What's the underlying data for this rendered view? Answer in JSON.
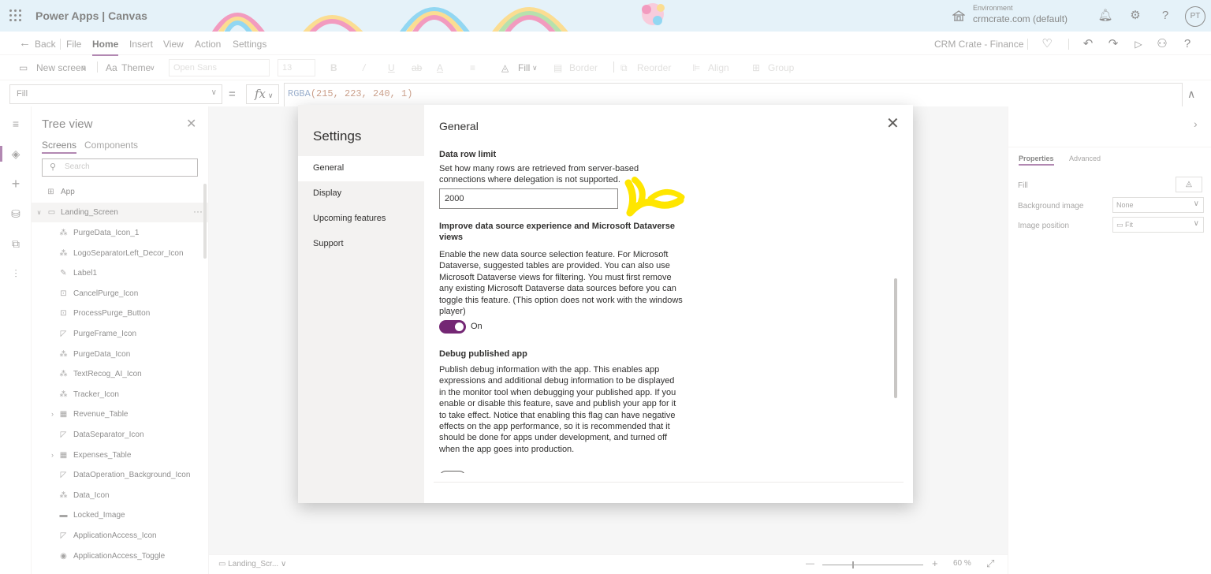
{
  "header": {
    "app_title": "Power Apps  |  Canvas",
    "environment_label": "Environment",
    "environment_value": "crmcrate.com (default)",
    "avatar_initials": "PT"
  },
  "menu": {
    "back": "Back",
    "items": [
      "File",
      "Home",
      "Insert",
      "View",
      "Action",
      "Settings"
    ],
    "app_name": "CRM Crate - Finance"
  },
  "toolbar": {
    "new_screen": "New screen",
    "theme": "Theme",
    "font": "Open Sans",
    "font_size": "13",
    "fill": "Fill",
    "border": "Border",
    "reorder": "Reorder",
    "align": "Align",
    "group": "Group"
  },
  "formula": {
    "property": "Fill",
    "equals": "=",
    "fx": "fx",
    "fn": "RGBA",
    "args": "(215, 223, 240, 1)"
  },
  "tree": {
    "title": "Tree view",
    "tabs": [
      "Screens",
      "Components"
    ],
    "search_placeholder": "Search",
    "app_label": "App",
    "screen_label": "Landing_Screen",
    "items": [
      {
        "label": "PurgeData_Icon_1",
        "icon": "icon-control-icon"
      },
      {
        "label": "LogoSeparatorLeft_Decor_Icon",
        "icon": "icon-control-icon"
      },
      {
        "label": "Label1",
        "icon": "label-icon"
      },
      {
        "label": "CancelPurge_Icon",
        "icon": "button-icon"
      },
      {
        "label": "ProcessPurge_Button",
        "icon": "button-icon"
      },
      {
        "label": "PurgeFrame_Icon",
        "icon": "shape-icon"
      },
      {
        "label": "PurgeData_Icon",
        "icon": "icon-control-icon"
      },
      {
        "label": "TextRecog_AI_Icon",
        "icon": "icon-control-icon"
      },
      {
        "label": "Tracker_Icon",
        "icon": "icon-control-icon"
      },
      {
        "label": "Revenue_Table",
        "icon": "table-icon"
      },
      {
        "label": "DataSeparator_Icon",
        "icon": "shape-icon"
      },
      {
        "label": "Expenses_Table",
        "icon": "table-icon"
      },
      {
        "label": "DataOperation_Background_Icon",
        "icon": "shape-icon"
      },
      {
        "label": "Data_Icon",
        "icon": "icon-control-icon"
      },
      {
        "label": "Locked_Image",
        "icon": "image-icon"
      },
      {
        "label": "ApplicationAccess_Icon",
        "icon": "shape-icon"
      },
      {
        "label": "ApplicationAccess_Toggle",
        "icon": "toggle-icon"
      }
    ]
  },
  "status": {
    "screen": "Landing_Scr...",
    "minus": "—",
    "plus": "+",
    "zoom": "60  %"
  },
  "properties": {
    "tabs": [
      "Properties",
      "Advanced"
    ],
    "fill_label": "Fill",
    "background_image_label": "Background image",
    "background_image_value": "None",
    "image_position_label": "Image position",
    "image_position_value": "Fit"
  },
  "settings": {
    "title": "Settings",
    "nav": [
      "General",
      "Display",
      "Upcoming features",
      "Support"
    ],
    "heading": "General",
    "data_row_limit_title": "Data row limit",
    "data_row_limit_desc": "Set how many rows are retrieved from server-based connections where delegation is not supported.",
    "data_row_limit_value": "2000",
    "improve_title": "Improve data source experience and Microsoft Dataverse views",
    "improve_desc": "Enable the new data source selection feature. For Microsoft Dataverse, suggested tables are provided. You can also use Microsoft Dataverse views for filtering. You must first remove any existing Microsoft Dataverse data sources before you can toggle this feature. (This option does not work with the windows player)",
    "improve_toggle_label": "On",
    "debug_title": "Debug published app",
    "debug_desc": "Publish debug information with the app. This enables app expressions and additional debug information to be displayed in the monitor tool when debugging your published app. If you enable or disable this feature, save and publish your app for it to take effect. Notice that enabling this flag can have negative effects on the app performance, so it is recommended that it should be done for apps under development, and turned off when the app goes into production."
  },
  "colors": {
    "accent": "#742774",
    "header_bg": "#cfe8f4",
    "annotation": "#ffe600"
  }
}
